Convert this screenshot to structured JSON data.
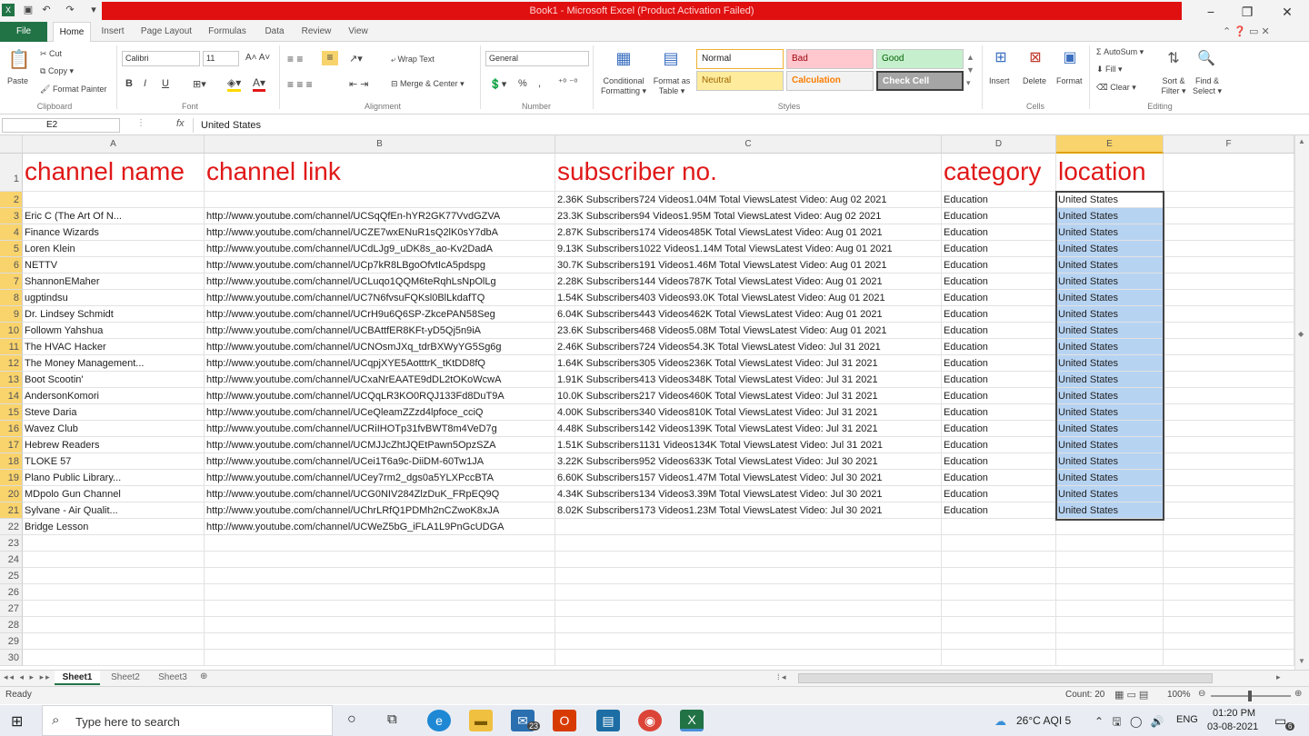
{
  "window": {
    "title": "Book1 - Microsoft Excel (Product Activation Failed)",
    "qat": [
      "save-icon",
      "undo-icon",
      "redo-icon"
    ],
    "controls": [
      "−",
      "❐",
      "✕"
    ]
  },
  "ribbon_tabs": [
    "File",
    "Home",
    "Insert",
    "Page Layout",
    "Formulas",
    "Data",
    "Review",
    "View"
  ],
  "ribbon": {
    "clipboard": {
      "paste": "Paste",
      "cut": "Cut",
      "copy": "Copy ▾",
      "format_painter": "Format Painter",
      "label": "Clipboard"
    },
    "font": {
      "name": "Calibri",
      "size": "11",
      "bold": "B",
      "italic": "I",
      "underline": "U",
      "label": "Font"
    },
    "alignment": {
      "wrap": "Wrap Text",
      "merge": "Merge & Center ▾",
      "label": "Alignment"
    },
    "number": {
      "format": "General",
      "percent": "%",
      "comma": ",",
      "label": "Number"
    },
    "styles": {
      "conditional": "Conditional Formatting ▾",
      "format_table": "Format as Table ▾",
      "normal": "Normal",
      "bad": "Bad",
      "good": "Good",
      "neutral": "Neutral",
      "calculation": "Calculation",
      "check_cell": "Check Cell",
      "label": "Styles"
    },
    "cells": {
      "insert": "Insert",
      "delete": "Delete",
      "format": "Format",
      "label": "Cells"
    },
    "editing": {
      "autosum": "AutoSum ▾",
      "fill": "Fill ▾",
      "clear": "Clear ▾",
      "sort": "Sort & Filter ▾",
      "find": "Find & Select ▾",
      "label": "Editing"
    }
  },
  "formula_bar": {
    "name_box": "E2",
    "fx": "fx",
    "content": "United States"
  },
  "columns": [
    "A",
    "B",
    "C",
    "D",
    "E",
    "F"
  ],
  "headers": {
    "a": "channel name",
    "b": "channel link",
    "c": "subscriber no.",
    "d": "category",
    "e": "location"
  },
  "rows": [
    {
      "n": "2",
      "a": "",
      "b": "",
      "c": "2.36K Subscribers724 Videos1.04M Total ViewsLatest Video: Aug 02 2021",
      "d": "Education",
      "e": "United States"
    },
    {
      "n": "3",
      "a": "Eric C (The Art Of N...",
      "b": "http://www.youtube.com/channel/UCSqQfEn-hYR2GK77VvdGZVA",
      "c": "23.3K Subscribers94 Videos1.95M Total ViewsLatest Video: Aug 02 2021",
      "d": "Education",
      "e": "United States"
    },
    {
      "n": "4",
      "a": "Finance Wizards",
      "b": "http://www.youtube.com/channel/UCZE7wxENuR1sQ2lK0sY7dbA",
      "c": "2.87K Subscribers174 Videos485K Total ViewsLatest Video: Aug 01 2021",
      "d": "Education",
      "e": "United States"
    },
    {
      "n": "5",
      "a": "Loren Klein",
      "b": "http://www.youtube.com/channel/UCdLJg9_uDK8s_ao-Kv2DadA",
      "c": "9.13K Subscribers1022 Videos1.14M Total ViewsLatest Video: Aug 01 2021",
      "d": "Education",
      "e": "United States"
    },
    {
      "n": "6",
      "a": "NETTV",
      "b": "http://www.youtube.com/channel/UCp7kR8LBgoOfvtIcA5pdspg",
      "c": "30.7K Subscribers191 Videos1.46M Total ViewsLatest Video: Aug 01 2021",
      "d": "Education",
      "e": "United States"
    },
    {
      "n": "7",
      "a": "ShannonEMaher",
      "b": "http://www.youtube.com/channel/UCLuqo1QQM6teRqhLsNpOlLg",
      "c": "2.28K Subscribers144 Videos787K Total ViewsLatest Video: Aug 01 2021",
      "d": "Education",
      "e": "United States"
    },
    {
      "n": "8",
      "a": "ugptindsu",
      "b": "http://www.youtube.com/channel/UC7N6fvsuFQKsl0BlLkdafTQ",
      "c": "1.54K Subscribers403 Videos93.0K Total ViewsLatest Video: Aug 01 2021",
      "d": "Education",
      "e": "United States"
    },
    {
      "n": "9",
      "a": "Dr. Lindsey Schmidt",
      "b": "http://www.youtube.com/channel/UCrH9u6Q6SP-ZkcePAN58Seg",
      "c": "6.04K Subscribers443 Videos462K Total ViewsLatest Video: Aug 01 2021",
      "d": "Education",
      "e": "United States"
    },
    {
      "n": "10",
      "a": "Followm Yahshua",
      "b": "http://www.youtube.com/channel/UCBAttfER8KFt-yD5Qj5n9iA",
      "c": "23.6K Subscribers468 Videos5.08M Total ViewsLatest Video: Aug 01 2021",
      "d": "Education",
      "e": "United States"
    },
    {
      "n": "11",
      "a": "The HVAC Hacker",
      "b": "http://www.youtube.com/channel/UCNOsmJXq_tdrBXWyYG5Sg6g",
      "c": "2.46K Subscribers724 Videos54.3K Total ViewsLatest Video: Jul 31 2021",
      "d": "Education",
      "e": "United States"
    },
    {
      "n": "12",
      "a": "The Money Management...",
      "b": "http://www.youtube.com/channel/UCqpjXYE5AotttrK_tKtDD8fQ",
      "c": "1.64K Subscribers305 Videos236K Total ViewsLatest Video: Jul 31 2021",
      "d": "Education",
      "e": "United States"
    },
    {
      "n": "13",
      "a": "Boot Scootin'",
      "b": "http://www.youtube.com/channel/UCxaNrEAATE9dDL2tOKoWcwA",
      "c": "1.91K Subscribers413 Videos348K Total ViewsLatest Video: Jul 31 2021",
      "d": "Education",
      "e": "United States"
    },
    {
      "n": "14",
      "a": "AndersonKomori",
      "b": "http://www.youtube.com/channel/UCQqLR3KO0RQJ133Fd8DuT9A",
      "c": "10.0K Subscribers217 Videos460K Total ViewsLatest Video: Jul 31 2021",
      "d": "Education",
      "e": "United States"
    },
    {
      "n": "15",
      "a": "Steve Daria",
      "b": "http://www.youtube.com/channel/UCeQleamZZzd4lpfoce_cciQ",
      "c": "4.00K Subscribers340 Videos810K Total ViewsLatest Video: Jul 31 2021",
      "d": "Education",
      "e": "United States"
    },
    {
      "n": "16",
      "a": "Wavez Club",
      "b": "http://www.youtube.com/channel/UCRiIHOTp31fvBWT8m4VeD7g",
      "c": "4.48K Subscribers142 Videos139K Total ViewsLatest Video: Jul 31 2021",
      "d": "Education",
      "e": "United States"
    },
    {
      "n": "17",
      "a": "Hebrew Readers",
      "b": "http://www.youtube.com/channel/UCMJJcZhtJQEtPawn5OpzSZA",
      "c": "1.51K Subscribers1131 Videos134K Total ViewsLatest Video: Jul 31 2021",
      "d": "Education",
      "e": "United States"
    },
    {
      "n": "18",
      "a": "TLOKE 57",
      "b": "http://www.youtube.com/channel/UCei1T6a9c-DiiDM-60Tw1JA",
      "c": "3.22K Subscribers952 Videos633K Total ViewsLatest Video: Jul 30 2021",
      "d": "Education",
      "e": "United States"
    },
    {
      "n": "19",
      "a": "Plano Public Library...",
      "b": "http://www.youtube.com/channel/UCey7rm2_dgs0a5YLXPccBTA",
      "c": "6.60K Subscribers157 Videos1.47M Total ViewsLatest Video: Jul 30 2021",
      "d": "Education",
      "e": "United States"
    },
    {
      "n": "20",
      "a": "MDpolo Gun Channel",
      "b": "http://www.youtube.com/channel/UCG0NIV284ZlzDuK_FRpEQ9Q",
      "c": "4.34K Subscribers134 Videos3.39M Total ViewsLatest Video: Jul 30 2021",
      "d": "Education",
      "e": "United States"
    },
    {
      "n": "21",
      "a": "Sylvane - Air Qualit...",
      "b": "http://www.youtube.com/channel/UChrLRfQ1PDMh2nCZwoK8xJA",
      "c": "8.02K Subscribers173 Videos1.23M Total ViewsLatest Video: Jul 30 2021",
      "d": "Education",
      "e": "United States"
    },
    {
      "n": "22",
      "a": "Bridge Lesson",
      "b": "http://www.youtube.com/channel/UCWeZ5bG_iFLA1L9PnGcUDGA",
      "c": "",
      "d": "",
      "e": ""
    }
  ],
  "empty_rows": [
    "23",
    "24",
    "25",
    "26",
    "27",
    "28",
    "29",
    "30"
  ],
  "sheets": [
    "Sheet1",
    "Sheet2",
    "Sheet3"
  ],
  "status": {
    "ready": "Ready",
    "count": "Count: 20",
    "zoom": "100%"
  },
  "taskbar": {
    "search": "Type here to search",
    "weather": "26°C  AQI 5",
    "lang": "ENG",
    "time": "01:20 PM",
    "date": "03-08-2021",
    "mail_badge": "23",
    "notif_badge": "6"
  },
  "colors": {
    "excel_green": "#217346",
    "title_red": "#e01010",
    "header_red": "#e01818",
    "selection": "#b7d3f2"
  }
}
